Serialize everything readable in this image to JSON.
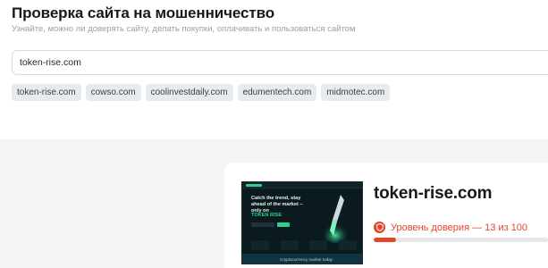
{
  "header": {
    "title": "Проверка сайта на мошенничество",
    "subtitle": "Узнайте, можно ли доверять сайту, делать покупки, оплачивать и пользоваться сайтом"
  },
  "search": {
    "value": "token-rise.com"
  },
  "recent_chips": [
    "token-rise.com",
    "cowso.com",
    "coolinvestdaily.com",
    "edumentech.com",
    "midmotec.com"
  ],
  "result": {
    "domain": "token-rise.com",
    "trust_label": "Уровень доверия — 13 из 100",
    "trust_score": 13,
    "trust_max": 100,
    "trust_color": "#e2472b",
    "shield_icon": "shield-icon",
    "screenshot": {
      "headline": "Catch the trend, stay ahead of the market – only on",
      "brand": "TOKEN RISE",
      "footer": "Cryptocurrency market today"
    }
  }
}
